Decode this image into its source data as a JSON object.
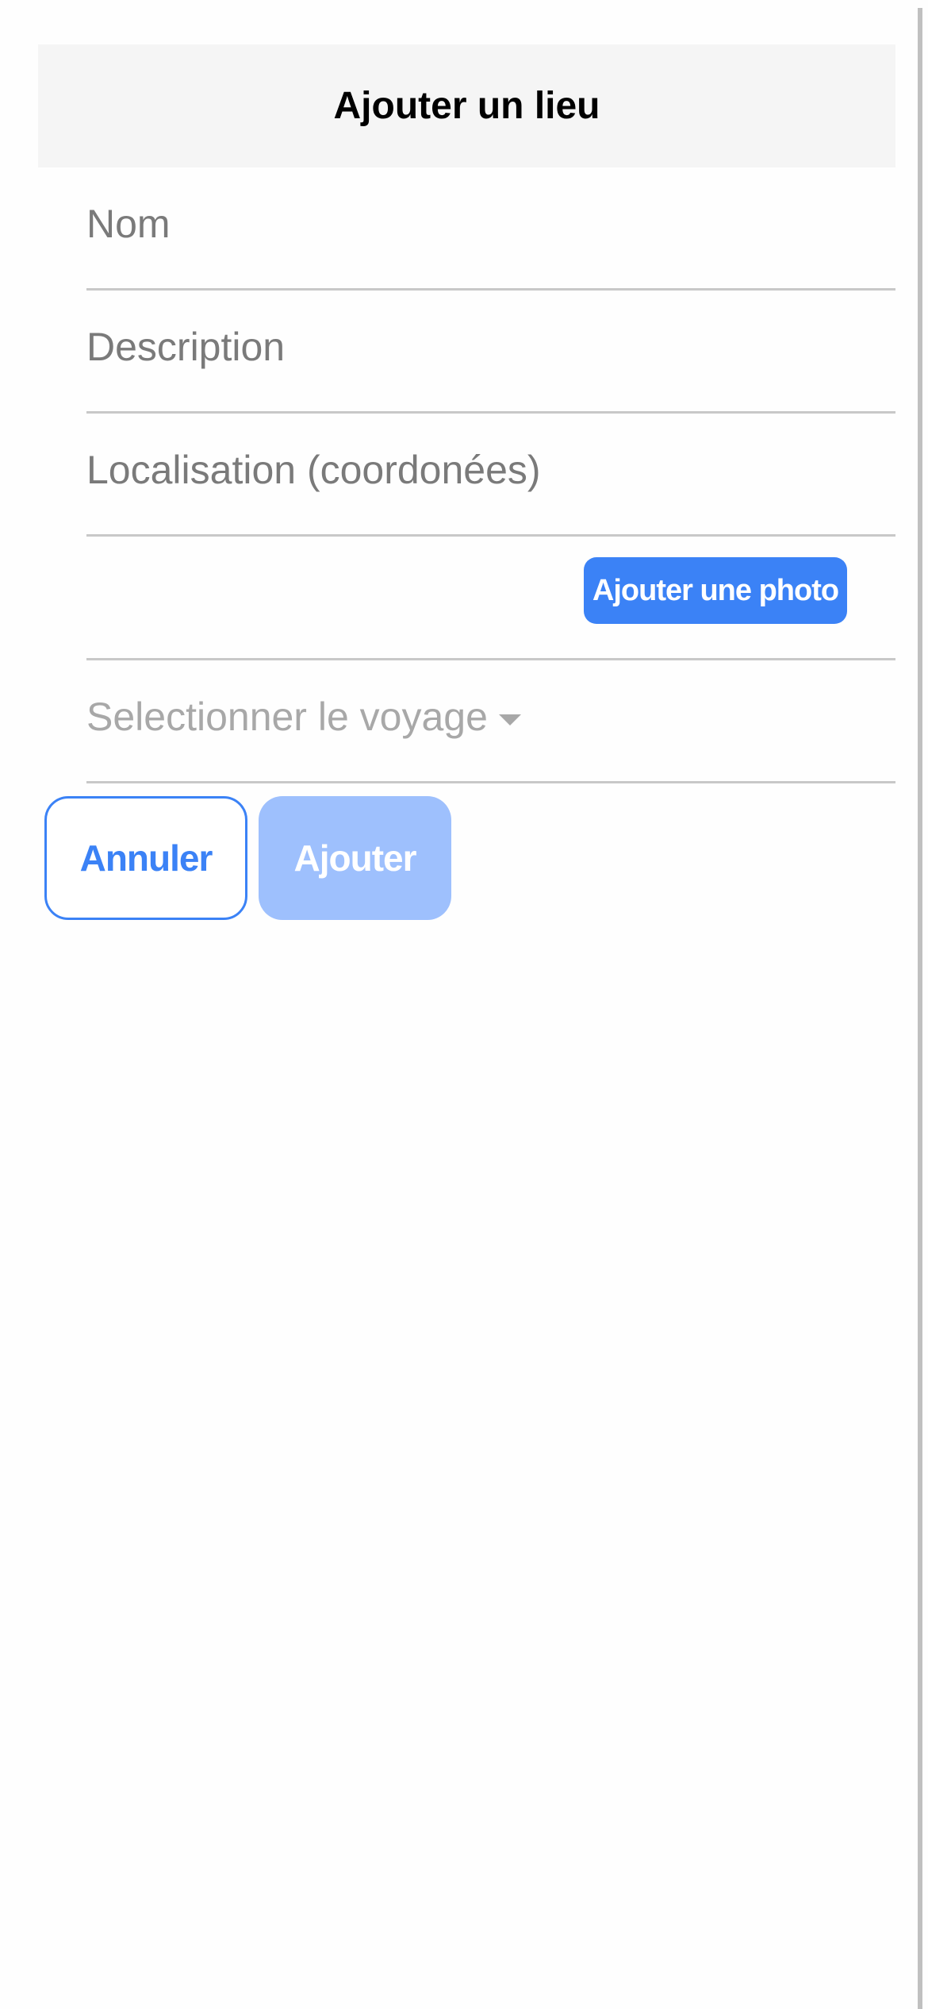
{
  "header": {
    "title": "Ajouter un lieu"
  },
  "form": {
    "name_placeholder": "Nom",
    "description_placeholder": "Description",
    "location_placeholder": "Localisation (coordonées)",
    "photo_button": "Ajouter une photo",
    "trip_select_placeholder": "Selectionner le voyage"
  },
  "actions": {
    "cancel": "Annuler",
    "submit": "Ajouter"
  },
  "colors": {
    "accent": "#3b82f6",
    "disabled_accent": "#9ec0fd",
    "header_bg": "#f5f5f5"
  }
}
